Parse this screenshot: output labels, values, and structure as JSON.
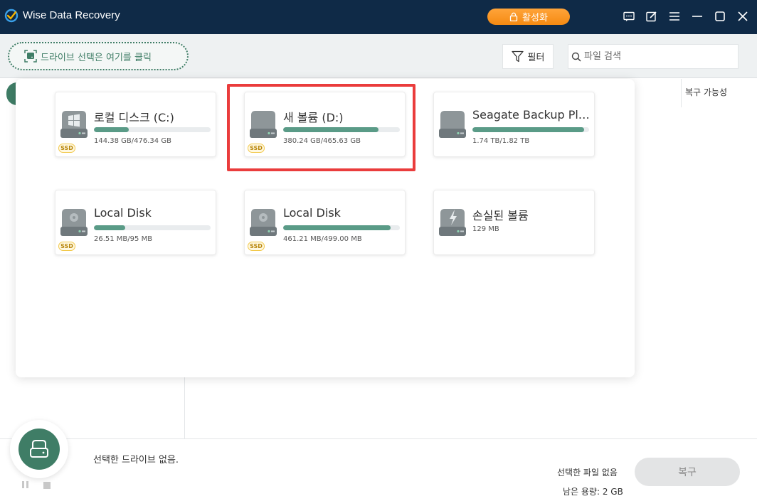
{
  "titlebar": {
    "app_title": "Wise Data Recovery",
    "activate_label": "활성화"
  },
  "toolbar": {
    "drive_select_label": "드라이브 선택은 여기를 클릭",
    "filter_label": "필터",
    "search_placeholder": "파일 검색"
  },
  "table": {
    "column_recoverability": "복구 가능성"
  },
  "drives": [
    {
      "name": "로컬 디스크 (C:)",
      "size": "144.38 GB/476.34 GB",
      "used_fraction": 0.3,
      "ssd": "SSD",
      "icon": "windows-drive-icon"
    },
    {
      "name": "새 볼륨 (D:)",
      "size": "380.24 GB/465.63 GB",
      "used_fraction": 0.82,
      "ssd": "SSD",
      "icon": "hard-drive-icon"
    },
    {
      "name": "Seagate Backup Plus ...",
      "size": "1.74 TB/1.82 TB",
      "used_fraction": 0.96,
      "ssd": "",
      "icon": "hard-drive-icon"
    },
    {
      "name": "Local Disk",
      "size": "26.51 MB/95 MB",
      "used_fraction": 0.27,
      "ssd": "SSD",
      "icon": "disc-drive-icon"
    },
    {
      "name": "Local Disk",
      "size": "461.21 MB/499.00 MB",
      "used_fraction": 0.92,
      "ssd": "SSD",
      "icon": "disc-drive-icon"
    },
    {
      "name": "손실된 볼륨",
      "size": "129 MB",
      "used_fraction": null,
      "ssd": "",
      "icon": "lost-volume-icon"
    }
  ],
  "status": {
    "no_drive_selected": "선택한 드라이브 없음.",
    "no_file_selected": "선택한 파일 없음",
    "remaining_capacity": "남은 용량: 2 GB",
    "restore_label": "복구"
  },
  "colors": {
    "titlebar_bg": "#0f2a47",
    "accent_green": "#3f7d66",
    "activate_orange": "#f58a12",
    "highlight_red": "#ea3c3c"
  }
}
